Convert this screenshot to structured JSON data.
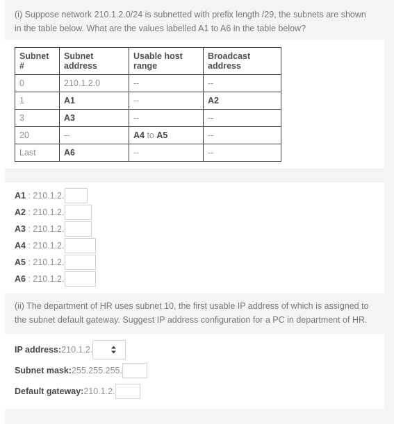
{
  "question_one": {
    "text": "(i) Suppose network 210.1.2.0/24 is subnetted with prefix length /29, the subnets are shown in the table below. What are the values labelled A1 to A6 in the table below?"
  },
  "subnet_table": {
    "headers": [
      "Subnet #",
      "Subnet address",
      "Usable host range",
      "Broadcast address"
    ],
    "rows": [
      {
        "num": "0",
        "address": "210.1.2.0",
        "address_bold": false,
        "range_a": "--",
        "range_conj": "",
        "range_b": "",
        "range_bold": false,
        "broadcast": "--",
        "broadcast_bold": false
      },
      {
        "num": "1",
        "address": "A1",
        "address_bold": true,
        "range_a": "--",
        "range_conj": "",
        "range_b": "",
        "range_bold": false,
        "broadcast": "A2",
        "broadcast_bold": true
      },
      {
        "num": "3",
        "address": "A3",
        "address_bold": true,
        "range_a": "--",
        "range_conj": "",
        "range_b": "",
        "range_bold": false,
        "broadcast": "--",
        "broadcast_bold": false
      },
      {
        "num": "20",
        "address": "--",
        "address_bold": false,
        "range_a": "A4",
        "range_conj": " to ",
        "range_b": "A5",
        "range_bold": true,
        "broadcast": "--",
        "broadcast_bold": false
      },
      {
        "num": "Last",
        "address": "A6",
        "address_bold": true,
        "range_a": "--",
        "range_conj": "",
        "range_b": "",
        "range_bold": false,
        "broadcast": "--",
        "broadcast_bold": false
      }
    ]
  },
  "answers": {
    "rows": [
      {
        "tag": "A1",
        "sep": " : ",
        "prefix": "210.1.2.",
        "value": "",
        "placeholder": ""
      },
      {
        "tag": "A2",
        "sep": " : ",
        "prefix": "210.1.2.",
        "value": "",
        "placeholder": ""
      },
      {
        "tag": "A3",
        "sep": " : ",
        "prefix": "210.1.2.",
        "value": "",
        "placeholder": ""
      },
      {
        "tag": "A4",
        "sep": " : ",
        "prefix": "210.1.2.",
        "value": "",
        "placeholder": ""
      },
      {
        "tag": "A5",
        "sep": " : ",
        "prefix": "210.1.2.",
        "value": "",
        "placeholder": ""
      },
      {
        "tag": "A6",
        "sep": " : ",
        "prefix": "210.1.2.",
        "value": "",
        "placeholder": ""
      }
    ]
  },
  "question_two": {
    "text": "(ii) The department of HR uses subnet 10, the first usable IP address of which is assigned to the subnet default gateway. Suggest IP address configuration for a PC in department of HR."
  },
  "config": {
    "ip": {
      "label": "IP address:",
      "prefix": "210.1.2.",
      "selected": "",
      "options": [
        ""
      ],
      "icon": "updown-spinner-icon"
    },
    "mask": {
      "label": "Subnet mask:",
      "prefix": "255.255.255.",
      "value": "",
      "placeholder": ""
    },
    "gateway": {
      "label": "Default gateway:",
      "prefix": "210.1.2.",
      "value": "",
      "placeholder": ""
    }
  },
  "colors": {
    "page_background": "#f4f4f4",
    "panel_background": "#ffffff",
    "body_text": "#73787d",
    "strong_text": "#46484b",
    "muted_text": "#8b9096",
    "table_border": "#3a3a3a",
    "input_border": "#cfcfcf"
  }
}
